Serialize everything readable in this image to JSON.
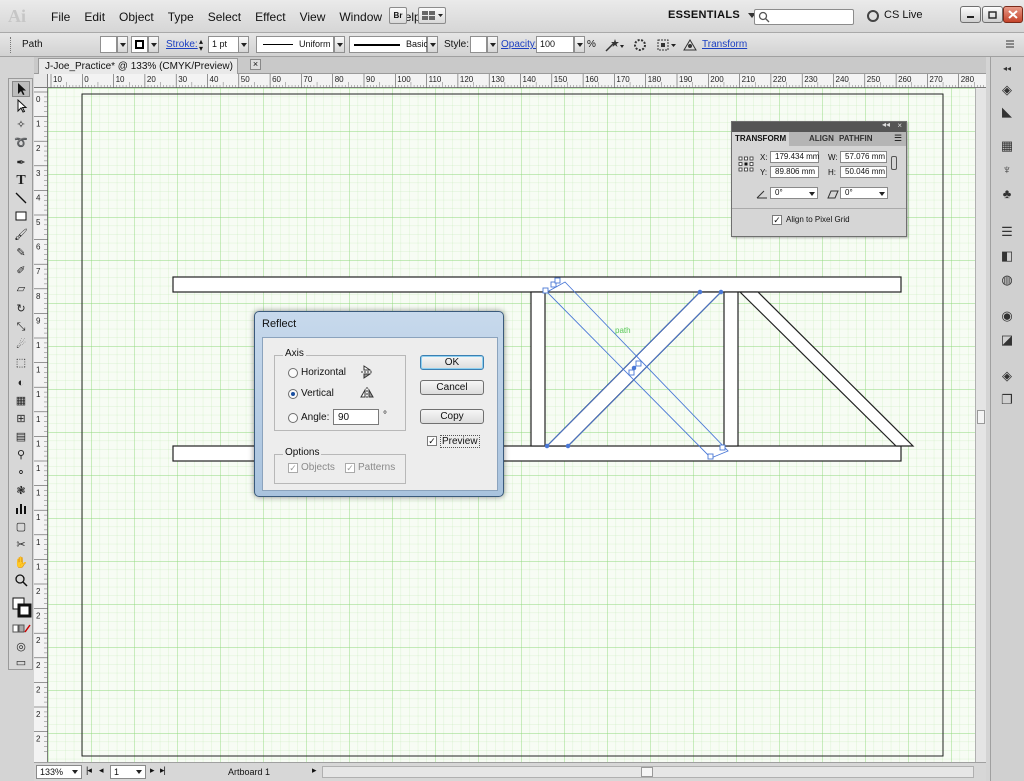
{
  "app": {
    "logo": "Ai",
    "menus": [
      "File",
      "Edit",
      "Object",
      "Type",
      "Select",
      "Effect",
      "View",
      "Window",
      "Help"
    ],
    "bridge": "Br",
    "workspace": "ESSENTIALS",
    "cslive": "CS Live"
  },
  "control": {
    "selection": "Path",
    "stroke_label": "Stroke:",
    "stroke_weight": "1 pt",
    "profile": "Uniform",
    "brush": "Basic",
    "style_label": "Style:",
    "opacity_label": "Opacity:",
    "opacity_value": "100",
    "opacity_unit": "%",
    "transform_link": "Transform"
  },
  "document": {
    "tab_title": "J-Joe_Practice* @ 133% (CMYK/Preview)",
    "close": "×"
  },
  "ruler": {
    "h_labels": [
      "10",
      "0",
      "10",
      "20",
      "30",
      "40",
      "50",
      "60",
      "70",
      "80",
      "90",
      "100",
      "110",
      "120",
      "130",
      "140",
      "150",
      "160",
      "170",
      "180",
      "190",
      "200",
      "210",
      "220",
      "230",
      "240",
      "250",
      "260",
      "270",
      "280"
    ],
    "v_labels": [
      "0",
      "1",
      "2",
      "3",
      "4",
      "5",
      "6",
      "7",
      "8",
      "9",
      "1",
      "1",
      "1",
      "1",
      "1",
      "1",
      "1",
      "1",
      "1",
      "1",
      "2",
      "2",
      "2",
      "2",
      "2",
      "2",
      "2"
    ]
  },
  "canvas": {
    "path_label": "path"
  },
  "transform_panel": {
    "tabs": [
      "TRANSFORM",
      "ALIGN",
      "PATHFIN"
    ],
    "x_label": "X:",
    "x_value": "179.434 mm",
    "y_label": "Y:",
    "y_value": "89.806 mm",
    "w_label": "W:",
    "w_value": "57.076 mm",
    "h_label": "H:",
    "h_value": "50.046 mm",
    "rotate_value": "0°",
    "shear_value": "0°",
    "align_pixel": "Align to Pixel Grid"
  },
  "reflect_dialog": {
    "title": "Reflect",
    "axis_label": "Axis",
    "horizontal": "Horizontal",
    "vertical": "Vertical",
    "angle_label": "Angle:",
    "angle_value": "90",
    "angle_unit": "°",
    "options_label": "Options",
    "objects": "Objects",
    "patterns": "Patterns",
    "ok": "OK",
    "cancel": "Cancel",
    "copy": "Copy",
    "preview": "Preview",
    "selected_axis": "vertical",
    "preview_checked": true
  },
  "status": {
    "zoom": "133%",
    "artboard_num": "1",
    "artboard_label": "Artboard 1"
  }
}
